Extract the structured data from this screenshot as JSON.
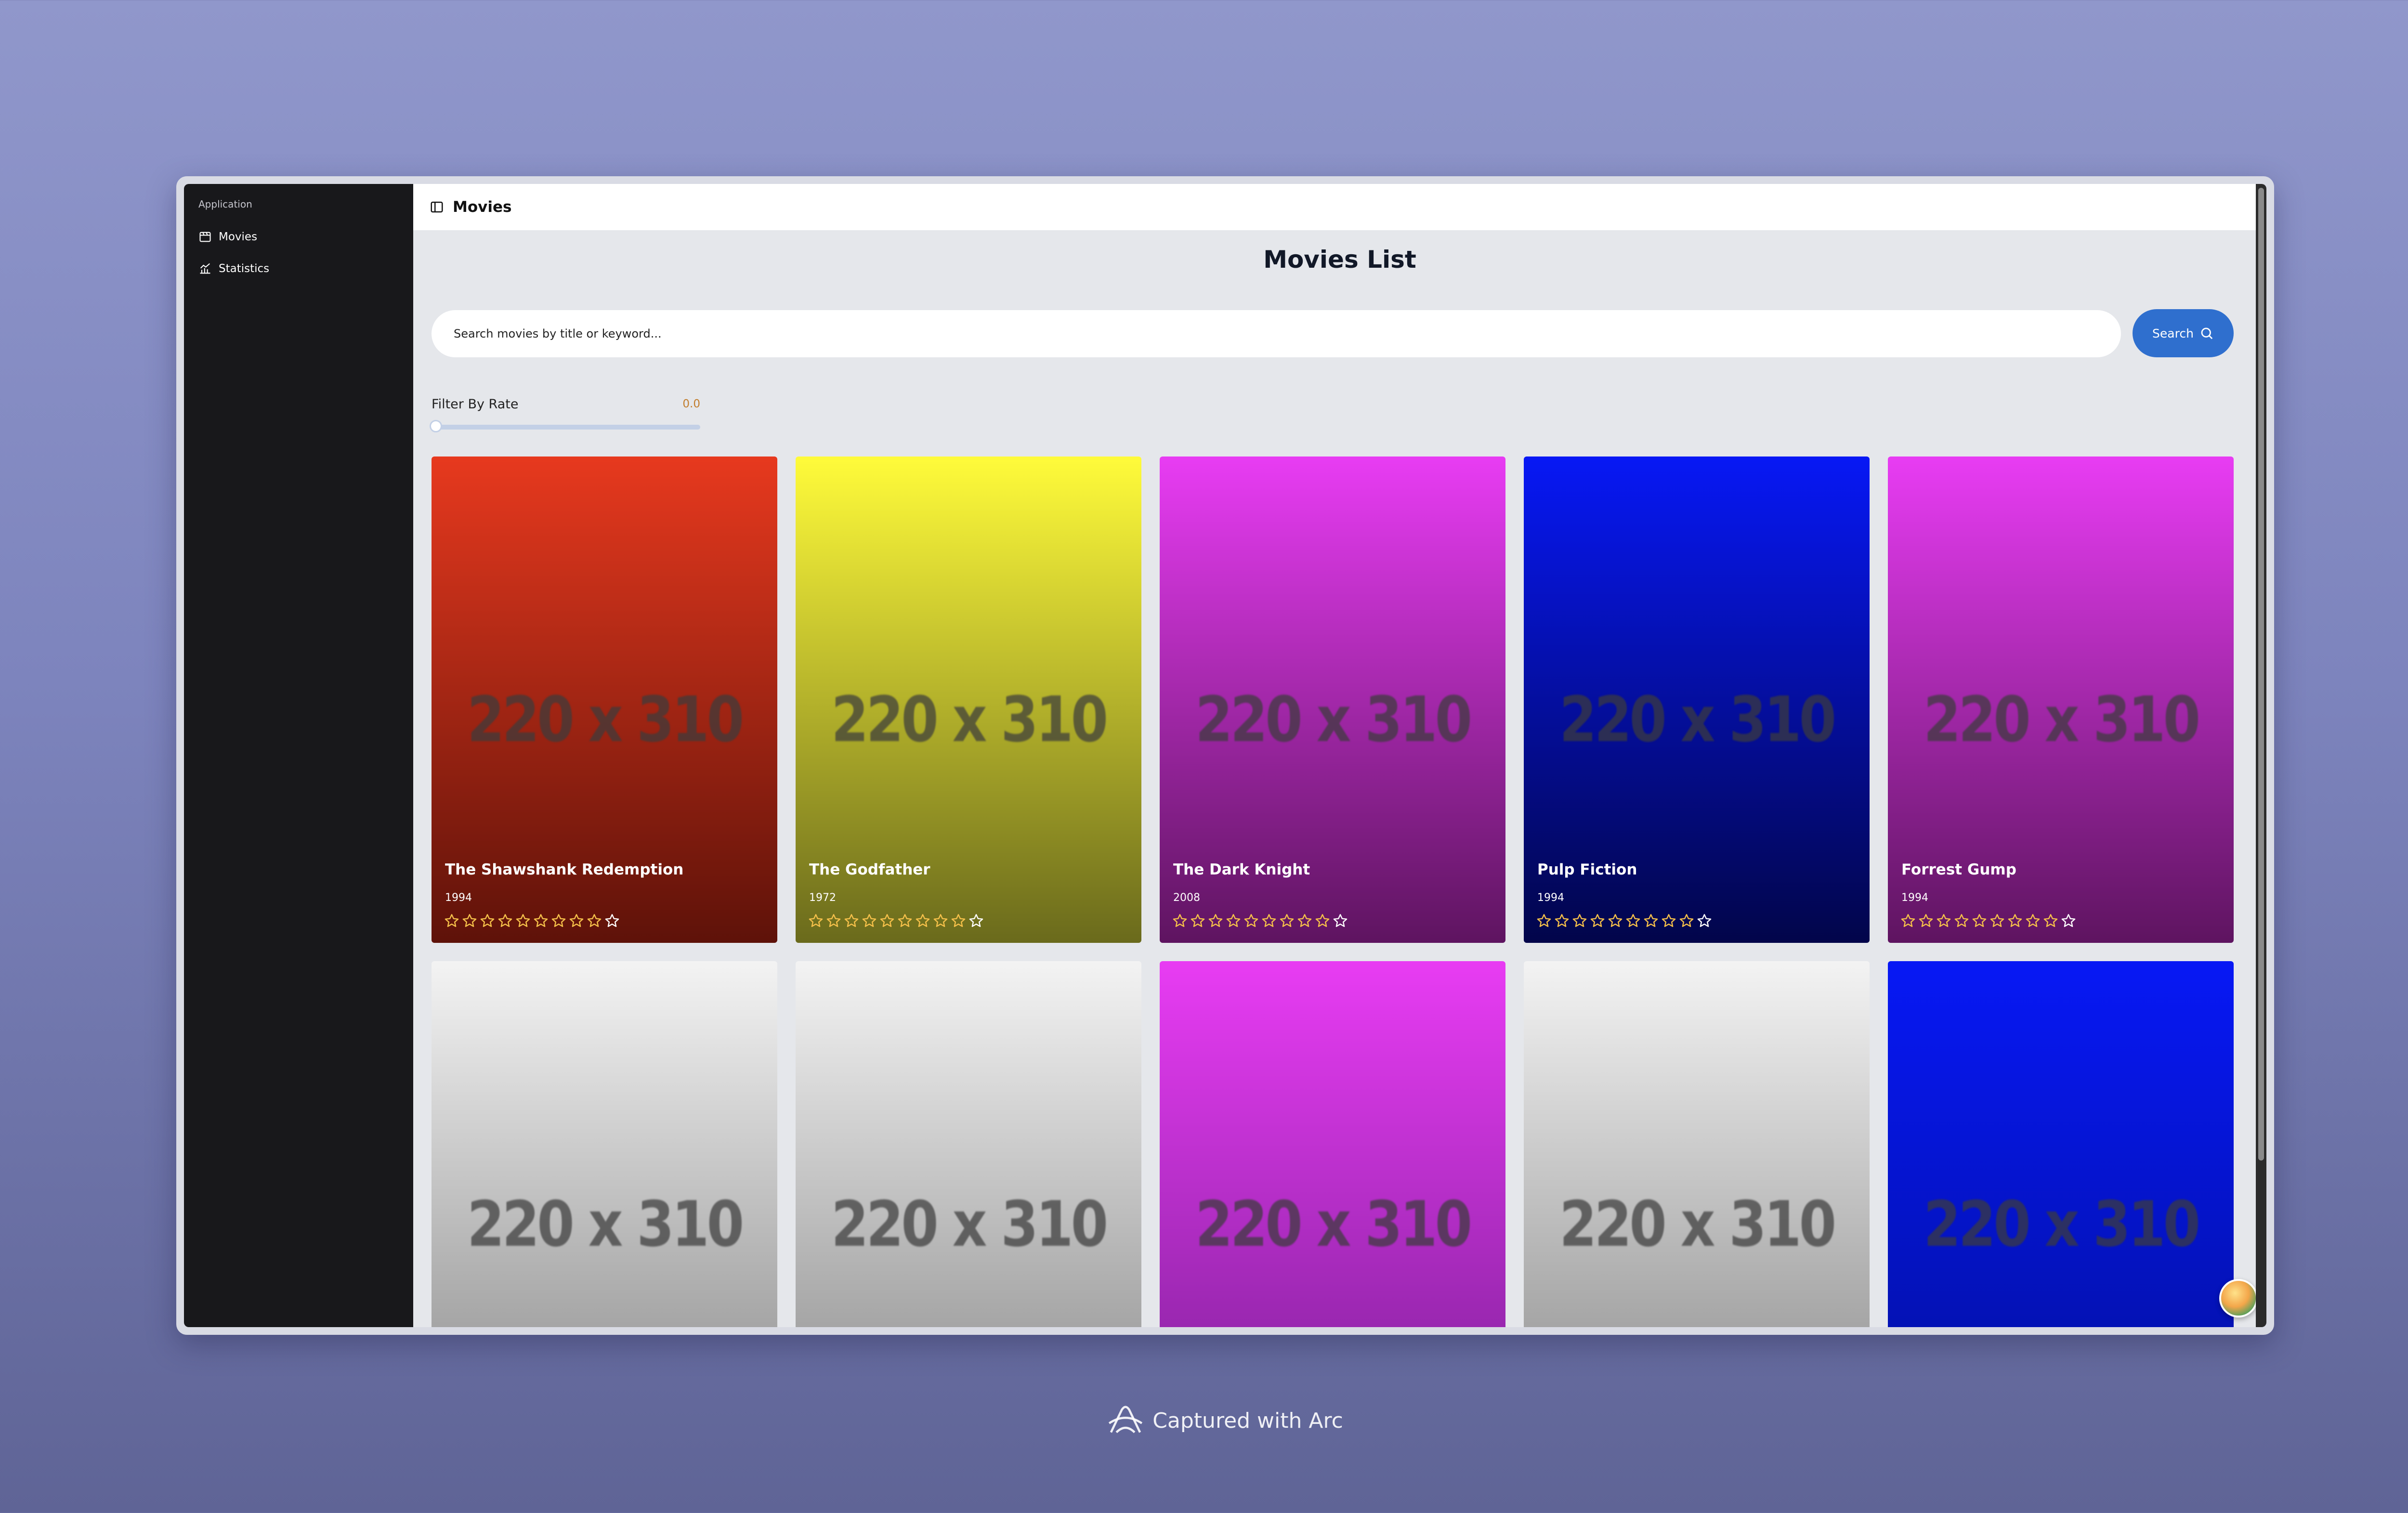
{
  "sidebar": {
    "group_label": "Application",
    "items": [
      {
        "label": "Movies",
        "icon": "film-icon"
      },
      {
        "label": "Statistics",
        "icon": "chart-icon"
      }
    ]
  },
  "topbar": {
    "title": "Movies",
    "icon": "sidebar-toggle-icon"
  },
  "page": {
    "title": "Movies List"
  },
  "search": {
    "placeholder": "Search movies by title or keyword...",
    "button_label": "Search"
  },
  "filter": {
    "label": "Filter By Rate",
    "value_label": "0.0",
    "value": 0.0,
    "max": 10
  },
  "colors": {
    "accent": "#2f6fce",
    "sidebar_bg": "#18181b",
    "star": "#f5c04a"
  },
  "movies": [
    {
      "placeholder": "220 x 310",
      "title": "The Shawshank Redemption",
      "year": "1994",
      "stars": 10,
      "filled": 9,
      "gradient": [
        "#e7391e",
        "#5e1209"
      ]
    },
    {
      "placeholder": "220 x 310",
      "title": "The Godfather",
      "year": "1972",
      "stars": 10,
      "filled": 9,
      "gradient": [
        "#fffb3a",
        "#6a6a1c"
      ]
    },
    {
      "placeholder": "220 x 310",
      "title": "The Dark Knight",
      "year": "2008",
      "stars": 10,
      "filled": 9,
      "gradient": [
        "#e83cf3",
        "#5e1460"
      ]
    },
    {
      "placeholder": "220 x 310",
      "title": "Pulp Fiction",
      "year": "1994",
      "stars": 10,
      "filled": 9,
      "gradient": [
        "#0718f5",
        "#02054a"
      ]
    },
    {
      "placeholder": "220 x 310",
      "title": "Forrest Gump",
      "year": "1994",
      "stars": 10,
      "filled": 9,
      "gradient": [
        "#e83cf3",
        "#5e1460"
      ]
    },
    {
      "placeholder": "220 x 310",
      "title": "",
      "year": "",
      "stars": 0,
      "filled": 0,
      "gradient": [
        "#f3f3f3",
        "#8c8c8c"
      ]
    },
    {
      "placeholder": "220 x 310",
      "title": "",
      "year": "",
      "stars": 0,
      "filled": 0,
      "gradient": [
        "#f3f3f3",
        "#8c8c8c"
      ]
    },
    {
      "placeholder": "220 x 310",
      "title": "",
      "year": "",
      "stars": 0,
      "filled": 0,
      "gradient": [
        "#e83cf3",
        "#80209a"
      ]
    },
    {
      "placeholder": "220 x 310",
      "title": "",
      "year": "",
      "stars": 0,
      "filled": 0,
      "gradient": [
        "#f3f3f3",
        "#8c8c8c"
      ]
    },
    {
      "placeholder": "220 x 310",
      "title": "",
      "year": "",
      "stars": 0,
      "filled": 0,
      "gradient": [
        "#0718f5",
        "#0210a0"
      ]
    }
  ],
  "footer": {
    "caption": "Captured with Arc"
  }
}
